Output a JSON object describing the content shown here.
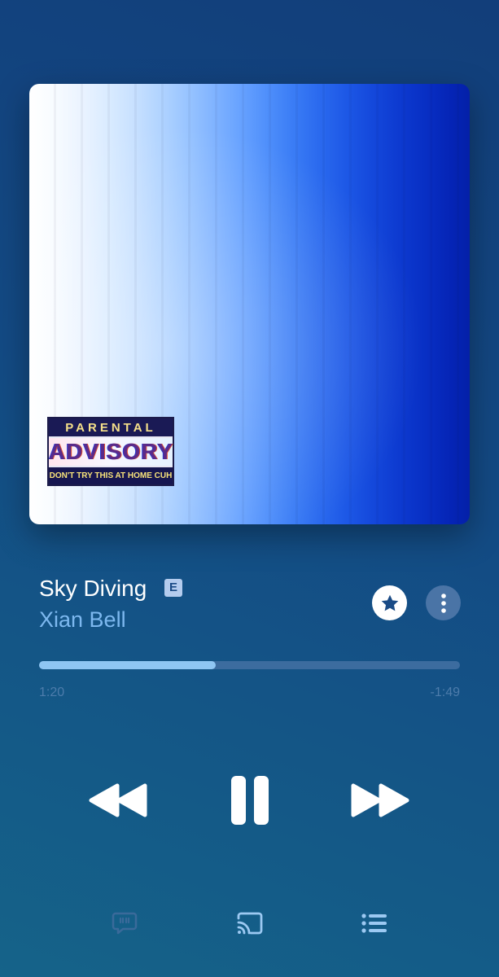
{
  "artwork": {
    "advisory": {
      "top": "PARENTAL",
      "middle": "ADVISORY",
      "bottom": "DON'T TRY THIS AT HOME CUH"
    }
  },
  "track": {
    "title": "Sky Diving",
    "explicit_badge": "E",
    "artist": "Xian Bell"
  },
  "progress": {
    "elapsed": "1:20",
    "remaining": "-1:49",
    "fraction": 0.42
  },
  "icons": {
    "favorite": "star-icon",
    "more": "more-vertical-icon",
    "rewind": "rewind-icon",
    "pause": "pause-icon",
    "fast_forward": "fast-forward-icon",
    "lyrics": "lyrics-bubble-icon",
    "cast": "cast-icon",
    "queue": "queue-list-icon"
  },
  "colors": {
    "accent": "#7db8ef",
    "progress_fill": "#8fc6f3",
    "progress_track": "#3c6c9f"
  }
}
